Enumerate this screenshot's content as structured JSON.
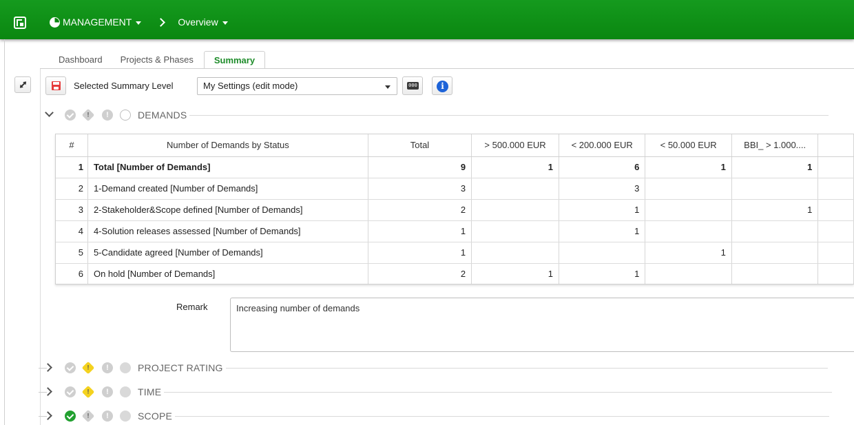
{
  "header": {
    "module_label": "MANAGEMENT",
    "page_label": "Overview"
  },
  "tabs": [
    {
      "label": "Dashboard",
      "active": false
    },
    {
      "label": "Projects & Phases",
      "active": false
    },
    {
      "label": "Summary",
      "active": true
    }
  ],
  "toolbar": {
    "level_label": "Selected Summary Level",
    "level_value": "My Settings (edit mode)",
    "counter_glyph": "000"
  },
  "sections": [
    {
      "label": "DEMANDS",
      "expanded": true,
      "check": false,
      "warn": false,
      "circle": "empty"
    },
    {
      "label": "PROJECT RATING",
      "expanded": false,
      "check": false,
      "warn": true,
      "circle": "grey"
    },
    {
      "label": "TIME",
      "expanded": false,
      "check": false,
      "warn": true,
      "circle": "grey"
    },
    {
      "label": "SCOPE",
      "expanded": false,
      "check": true,
      "warn": false,
      "circle": "grey"
    }
  ],
  "table": {
    "columns": [
      "#",
      "Number of Demands by Status",
      "Total",
      "> 500.000 EUR",
      "< 200.000 EUR",
      "< 50.000 EUR",
      "BBI_ > 1.000....",
      ""
    ],
    "rows": [
      {
        "cells": [
          "1",
          "Total [Number of Demands]",
          "9",
          "1",
          "6",
          "1",
          "1",
          ""
        ],
        "bold": true
      },
      {
        "cells": [
          "2",
          "1-Demand created [Number of Demands]",
          "3",
          "",
          "3",
          "",
          "",
          ""
        ],
        "bold": false
      },
      {
        "cells": [
          "3",
          "2-Stakeholder&Scope defined [Number of Demands]",
          "2",
          "",
          "1",
          "",
          "1",
          ""
        ],
        "bold": false
      },
      {
        "cells": [
          "4",
          "4-Solution releases assessed [Number of Demands]",
          "1",
          "",
          "1",
          "",
          "",
          ""
        ],
        "bold": false
      },
      {
        "cells": [
          "5",
          "5-Candidate agreed [Number of Demands]",
          "1",
          "",
          "",
          "1",
          "",
          ""
        ],
        "bold": false
      },
      {
        "cells": [
          "6",
          "On hold [Number of Demands]",
          "2",
          "1",
          "1",
          "",
          "",
          ""
        ],
        "bold": false
      }
    ]
  },
  "remark": {
    "label": "Remark",
    "value": "Increasing number of demands"
  },
  "colors": {
    "header_green": "#0a8710",
    "active_tab": "#1e8c2a",
    "check_green": "#22a030",
    "warn_yellow": "#f4d21f",
    "info_blue": "#1d63d8",
    "save_red": "#e63b3b"
  }
}
